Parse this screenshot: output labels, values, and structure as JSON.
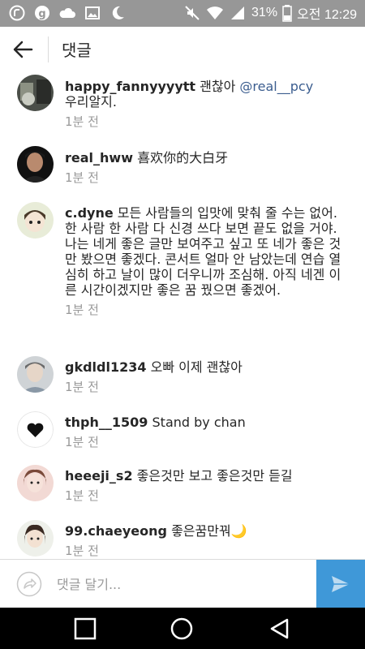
{
  "status_bar": {
    "battery": "31%",
    "time": "오전 12:29",
    "left_icons": [
      "facebook-messenger-icon",
      "g-app-icon",
      "cloud-icon",
      "image-icon",
      "moon-icon"
    ],
    "right_icons": [
      "mute-icon",
      "wifi-icon",
      "signal-icon",
      "battery-icon"
    ]
  },
  "header": {
    "title": "댓글"
  },
  "comments": [
    {
      "username": "happy_fannyyyytt",
      "text": "괜찮아 ",
      "mention": "@real__pcy",
      "text_after": "우리알지.",
      "time": "1분 전"
    },
    {
      "username": "real_hww",
      "text": "喜欢你的大白牙",
      "time": "1분 전"
    },
    {
      "username": "c.dyne",
      "text": "모든 사람들의 입맛에 맞춰 줄 수는 없어. 한 사람 한 사람 다 신경 쓰다 보면 끝도 없을 거야. 나는 네게 좋은 글만 보여주고 싶고 또 네가 좋은 것만 봤으면 좋겠다. 콘서트 얼마 안 남았는데 연습 열심히 하고 날이 많이 더우니까 조심해. 아직 네겐 이른 시간이겠지만 좋은 꿈 꿨으면 좋겠어.",
      "time": "1분 전"
    },
    {
      "username": "gkdldl1234",
      "text": "오빠 이제 괜찮아",
      "time": "1분 전"
    },
    {
      "username": "thph__1509",
      "text": "Stand by chan",
      "time": "1분 전"
    },
    {
      "username": "heeeji_s2",
      "text": "좋은것만 보고 좋은것만 듣길",
      "time": "1분 전"
    },
    {
      "username": "99.chaeyeong",
      "text": "좋은꿈만꿔🌙",
      "time": "1분 전"
    }
  ],
  "composer": {
    "placeholder": "댓글 달기..."
  },
  "colors": {
    "status_bar": "#979797",
    "send_button": "#3f98d8",
    "timestamp": "#999999",
    "mention": "#3b5d8f"
  }
}
